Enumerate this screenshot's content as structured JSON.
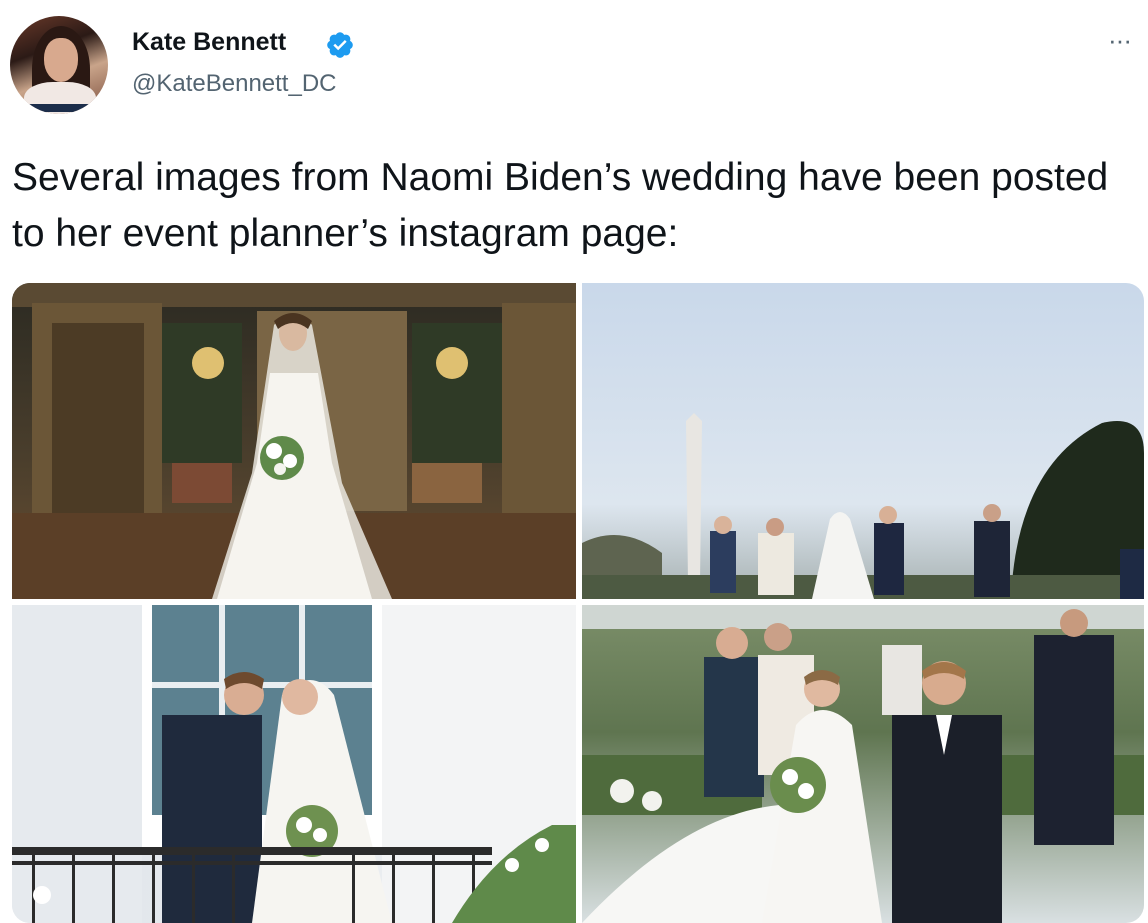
{
  "author": {
    "display_name": "Kate Bennett",
    "handle": "@KateBennett_DC",
    "verified": true,
    "avatar_icon": "profile-photo"
  },
  "menu": {
    "more_icon": "more-options-icon",
    "more_label": "···"
  },
  "tweet": {
    "text": "Several images from Naomi Biden’s wedding have been posted to her event planner’s instagram page:"
  },
  "media": {
    "photos": [
      {
        "id": "bride-portrait"
      },
      {
        "id": "outdoor-ceremony"
      },
      {
        "id": "balcony-kiss"
      },
      {
        "id": "couple-walking"
      }
    ]
  },
  "colors": {
    "text_primary": "#0f1419",
    "text_secondary": "#536471",
    "verified_blue": "#1d9bf0"
  }
}
